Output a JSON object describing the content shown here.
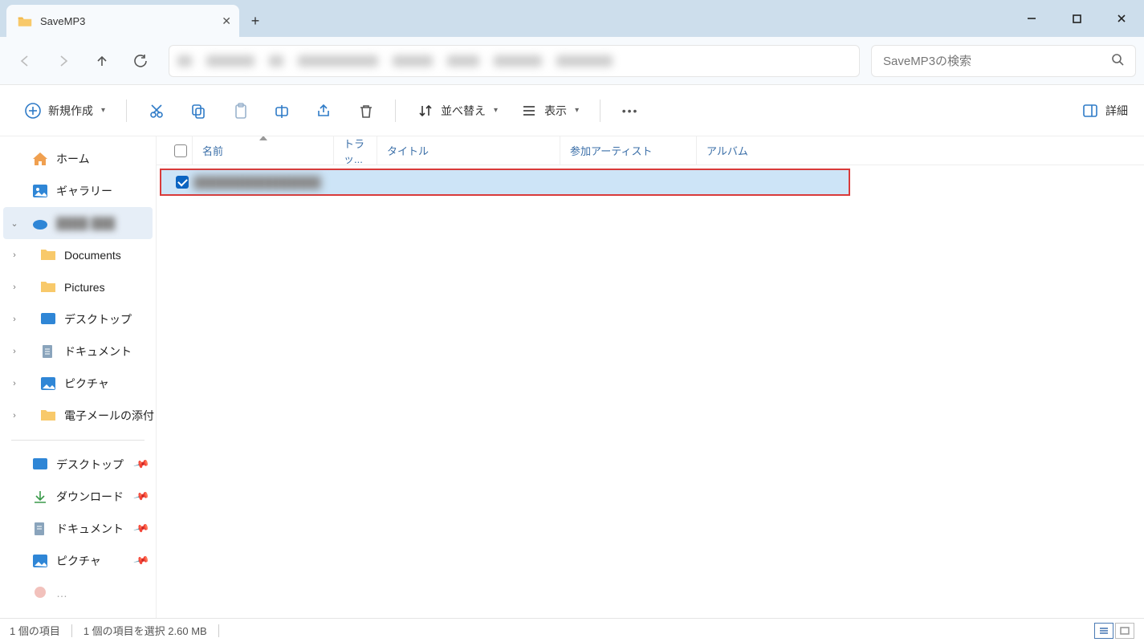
{
  "tab": {
    "title": "SaveMP3"
  },
  "search": {
    "placeholder": "SaveMP3の検索"
  },
  "toolbar": {
    "new_label": "新規作成",
    "sort_label": "並べ替え",
    "view_label": "表示",
    "detail_label": "詳細"
  },
  "columns": {
    "name": "名前",
    "track": "トラッ...",
    "title": "タイトル",
    "artist": "参加アーティスト",
    "album": "アルバム"
  },
  "sidebar": {
    "home": "ホーム",
    "gallery": "ギャラリー",
    "documents": "Documents",
    "pictures": "Pictures",
    "desktop": "デスクトップ",
    "documents_jp": "ドキュメント",
    "pictures_jp": "ピクチャ",
    "email": "電子メールの添付",
    "q_desktop": "デスクトップ",
    "q_downloads": "ダウンロード",
    "q_documents": "ドキュメント",
    "q_pictures": "ピクチャ"
  },
  "status": {
    "count": "1 個の項目",
    "selected": "1 個の項目を選択 2.60 MB"
  }
}
